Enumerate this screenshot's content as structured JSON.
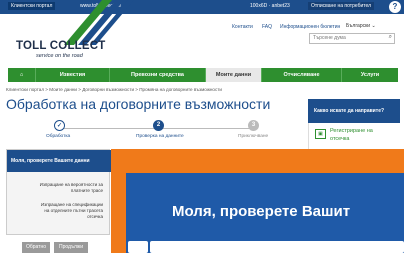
{
  "topbar": {
    "tabs": [
      "Клиентски портал",
      "www.toll-collect.de"
    ],
    "user": "100x6D · anbet23",
    "logout": "Отписване на потребител",
    "help": "?"
  },
  "logo": {
    "title": "TOLL COLLECT",
    "subtitle": "service on the road"
  },
  "header": {
    "links": [
      "Контакти",
      "FAQ",
      "Информационен бюлетин"
    ],
    "language": "Български ⌄",
    "search_placeholder": "Търсене дума",
    "search_icon": "⌕"
  },
  "nav": {
    "items": [
      "⌂",
      "Известия",
      "Превозни средства",
      "Моите данни",
      "Отчисляване",
      "Услуги"
    ],
    "active_index": 3
  },
  "breadcrumb": "Клиентски портал > Моите данни > Договорни възможности > Промяна на договорните възможности",
  "page_title": "Обработка на договорните възможности",
  "stepper": {
    "steps": [
      {
        "number": "✓",
        "label": "Обработка"
      },
      {
        "number": "2",
        "label": "Проверка на данните"
      },
      {
        "number": "3",
        "label": "Приключване"
      }
    ]
  },
  "right_panel": {
    "header": "Какво искате да направите?",
    "link_icon": "▣",
    "link_line1": "Регистриране на",
    "link_line2": "отсечка"
  },
  "left_box": {
    "header": "Моля, проверете Вашите данни",
    "items": [
      [
        "Изпращане на вероятности за",
        "платните трасе"
      ],
      [
        "Изпращане на спецификации",
        "на отделните пътни трасета",
        "отсечка"
      ]
    ],
    "buttons": [
      "Обратно",
      "Продължи"
    ]
  },
  "overlay": {
    "zoom_text": "Моля, проверете Вашит"
  },
  "colors": {
    "brand_blue": "#1d4e8c",
    "nav_green": "#2e8f2f",
    "highlight_orange": "#f07a1a"
  }
}
